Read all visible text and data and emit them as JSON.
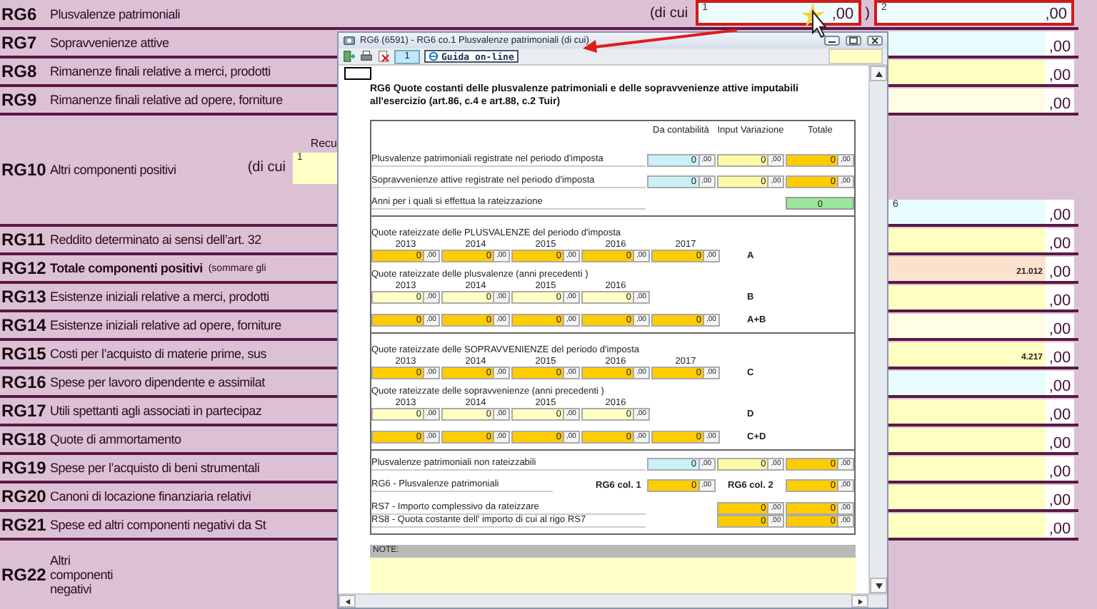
{
  "form": {
    "rows": [
      {
        "code": "RG6",
        "label": "Plusvalenze patrimoniali",
        "kind": "split",
        "note": "(di cui",
        "parts": [
          {
            "index": "1",
            "cents": ",00",
            "highlighted": true
          },
          {
            "index": "2",
            "cents": ",00",
            "highlighted": true
          }
        ],
        "closing": ")"
      },
      {
        "code": "RG7",
        "label": "Sopravvenienze attive",
        "kind": "plain",
        "field": {
          "kind": "imported",
          "cents": ",00"
        }
      },
      {
        "code": "RG8",
        "label": "Rimanenze finali relative a merci, prodotti",
        "kind": "plain",
        "field": {
          "kind": "input",
          "cents": ",00"
        }
      },
      {
        "code": "RG9",
        "label": "Rimanenze finali relative ad opere, forniture",
        "kind": "plain",
        "field": {
          "kind": "optional",
          "cents": ",00"
        }
      },
      {
        "code": "RG10",
        "label": "Altri componenti positivi",
        "kind": "detail",
        "note": "(di cui",
        "caption": "Recu",
        "part": {
          "index": "1"
        },
        "field": {
          "kind": "imported",
          "index": "6",
          "cents": ",00"
        }
      },
      {
        "code": "RG11",
        "label": "Reddito determinato ai sensi dell’art. 32",
        "kind": "plain",
        "field": {
          "kind": "input",
          "cents": ",00"
        }
      },
      {
        "code": "RG12",
        "label": "Totale componenti positivi",
        "kind": "total",
        "note": "(sommare gli",
        "field": {
          "kind": "total",
          "value": "21.012",
          "cents": ",00"
        }
      },
      {
        "code": "RG13",
        "label": "Esistenze iniziali relative a merci, prodotti",
        "kind": "plain",
        "field": {
          "kind": "input",
          "cents": ",00"
        }
      },
      {
        "code": "RG14",
        "label": "Esistenze iniziali relative ad opere, forniture",
        "kind": "plain",
        "field": {
          "kind": "optional",
          "cents": ",00"
        }
      },
      {
        "code": "RG15",
        "label": "Costi per l’acquisto di materie prime, sus",
        "kind": "plain",
        "field": {
          "kind": "input",
          "value": "4.217",
          "cents": ",00"
        }
      },
      {
        "code": "RG16",
        "label": "Spese per lavoro dipendente e assimilat",
        "kind": "plain",
        "field": {
          "kind": "imported",
          "cents": ",00"
        }
      },
      {
        "code": "RG17",
        "label": "Utili spettanti agli associati in partecipaz",
        "kind": "plain",
        "field": {
          "kind": "input",
          "cents": ",00"
        }
      },
      {
        "code": "RG18",
        "label": "Quote di ammortamento",
        "kind": "plain",
        "field": {
          "kind": "input",
          "cents": ",00"
        }
      },
      {
        "code": "RG19",
        "label": "Spese per l’acquisto di beni strumentali",
        "kind": "plain",
        "field": {
          "kind": "input",
          "cents": ",00"
        }
      },
      {
        "code": "RG20",
        "label": "Canoni di locazione finanziaria relativi",
        "kind": "plain",
        "field": {
          "kind": "input",
          "cents": ",00"
        }
      },
      {
        "code": "RG21",
        "label": "Spese ed altri componenti negativi da St",
        "kind": "plain",
        "field": {
          "kind": "input",
          "cents": ",00"
        }
      },
      {
        "code": "RG22",
        "label": "Altri componenti negativi",
        "kind": "tall"
      }
    ]
  },
  "dialog": {
    "title": "RG6 (6591) - RG6 co.1 Plusvalenze patrimoniali (di cui)",
    "toolbar": {
      "page": "1",
      "help": "Guida on-line"
    },
    "heading": "RG6 Quote costanti delle plusvalenze patrimoniali e delle sopravvenienze attive imputabili all'esercizio (art.86, c.4 e art.88, c.2 Tuir)",
    "columns": [
      "Da contabilità",
      "Input Variazione",
      "Totale"
    ],
    "amount_rows": [
      {
        "label": "Plusvalenze patrimoniali registrate nel periodo d'imposta",
        "cells": [
          {
            "kind": "imported",
            "value": "0",
            "cents": ",00"
          },
          {
            "kind": "input",
            "value": "0",
            "cents": ",00"
          },
          {
            "kind": "total",
            "value": "0",
            "cents": ",00"
          }
        ]
      },
      {
        "label": "Sopravvenienze attive registrate nel periodo d'imposta",
        "cells": [
          {
            "kind": "imported",
            "value": "0",
            "cents": ",00"
          },
          {
            "kind": "input",
            "value": "0",
            "cents": ",00"
          },
          {
            "kind": "total",
            "value": "0",
            "cents": ",00"
          }
        ]
      }
    ],
    "years_row": {
      "label": "Anni per i quali si effettua la rateizzazione",
      "value": "0"
    },
    "sections": [
      {
        "groups": [
          {
            "title": "Quote rateizzate delle PLUSVALENZE del periodo d'imposta",
            "years": [
              "2013",
              "2014",
              "2015",
              "2016",
              "2017"
            ],
            "tag": "A",
            "cells": [
              {
                "kind": "total",
                "value": "0",
                "cents": ",00"
              },
              {
                "kind": "total",
                "value": "0",
                "cents": ",00"
              },
              {
                "kind": "total",
                "value": "0",
                "cents": ",00"
              },
              {
                "kind": "total",
                "value": "0",
                "cents": ",00"
              },
              {
                "kind": "total",
                "value": "0",
                "cents": ",00"
              }
            ]
          },
          {
            "title": "Quote rateizzate delle plusvalenze  (anni precedenti )",
            "years": [
              "2013",
              "2014",
              "2015",
              "2016"
            ],
            "tag": "B",
            "cells": [
              {
                "kind": "optional",
                "value": "0",
                "cents": ",00"
              },
              {
                "kind": "optional",
                "value": "0",
                "cents": ",00"
              },
              {
                "kind": "optional",
                "value": "0",
                "cents": ",00"
              },
              {
                "kind": "optional",
                "value": "0",
                "cents": ",00"
              }
            ]
          },
          {
            "tag": "A+B",
            "cells": [
              {
                "kind": "total",
                "value": "0",
                "cents": ",00"
              },
              {
                "kind": "total",
                "value": "0",
                "cents": ",00"
              },
              {
                "kind": "total",
                "value": "0",
                "cents": ",00"
              },
              {
                "kind": "total",
                "value": "0",
                "cents": ",00"
              },
              {
                "kind": "total",
                "value": "0",
                "cents": ",00"
              }
            ]
          }
        ]
      },
      {
        "groups": [
          {
            "title": "Quote rateizzate delle SOPRAVVENIENZE del periodo d'imposta",
            "years": [
              "2013",
              "2014",
              "2015",
              "2016",
              "2017"
            ],
            "tag": "C",
            "cells": [
              {
                "kind": "total",
                "value": "0",
                "cents": ",00"
              },
              {
                "kind": "total",
                "value": "0",
                "cents": ",00"
              },
              {
                "kind": "total",
                "value": "0",
                "cents": ",00"
              },
              {
                "kind": "total",
                "value": "0",
                "cents": ",00"
              },
              {
                "kind": "total",
                "value": "0",
                "cents": ",00"
              }
            ]
          },
          {
            "title": "Quote rateizzate delle sopravvenienze  (anni precedenti )",
            "years": [
              "2013",
              "2014",
              "2015",
              "2016"
            ],
            "tag": "D",
            "cells": [
              {
                "kind": "optional",
                "value": "0",
                "cents": ",00"
              },
              {
                "kind": "optional",
                "value": "0",
                "cents": ",00"
              },
              {
                "kind": "optional",
                "value": "0",
                "cents": ",00"
              },
              {
                "kind": "optional",
                "value": "0",
                "cents": ",00"
              }
            ]
          },
          {
            "tag": "C+D",
            "cells": [
              {
                "kind": "total",
                "value": "0",
                "cents": ",00"
              },
              {
                "kind": "total",
                "value": "0",
                "cents": ",00"
              },
              {
                "kind": "total",
                "value": "0",
                "cents": ",00"
              },
              {
                "kind": "total",
                "value": "0",
                "cents": ",00"
              },
              {
                "kind": "total",
                "value": "0",
                "cents": ",00"
              }
            ]
          }
        ]
      }
    ],
    "extra_row": {
      "label": "Plusvalenze patrimoniali non rateizzabili",
      "cells": [
        {
          "kind": "imported",
          "value": "0",
          "cents": ",00"
        },
        {
          "kind": "input",
          "value": "0",
          "cents": ",00"
        },
        {
          "kind": "total",
          "value": "0",
          "cents": ",00"
        }
      ]
    },
    "result_row": {
      "label": "RG6 - Plusvalenze patrimoniali",
      "parts": [
        {
          "caption": "RG6 col. 1",
          "cell": {
            "kind": "total",
            "value": "0",
            "cents": ",00"
          }
        },
        {
          "caption": "RG6 col. 2",
          "cell": {
            "kind": "total",
            "value": "0",
            "cents": ",00"
          }
        }
      ]
    },
    "summary_rows": [
      {
        "label": "RS7 - Importo complessivo da rateizzare",
        "cells": [
          {
            "kind": "total",
            "value": "0",
            "cents": ",00"
          },
          {
            "kind": "total",
            "value": "0",
            "cents": ",00"
          }
        ]
      },
      {
        "label": "RS8 - Quota costante dell' importo di cui al rigo RS7",
        "cells": [
          {
            "kind": "total",
            "value": "0",
            "cents": ",00"
          },
          {
            "kind": "total",
            "value": "0",
            "cents": ",00"
          }
        ]
      }
    ],
    "notes": {
      "label": "NOTE:"
    }
  }
}
